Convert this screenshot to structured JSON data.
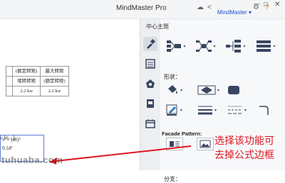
{
  "app": {
    "title": "MindMaster Pro",
    "brand": "MindMaster",
    "brand_chevron": "▾"
  },
  "document": {
    "table": [
      [
        "",
        "(额定转矩)",
        "最大转矩"
      ],
      [
        "",
        "堵转转矩",
        "(额定转矩)"
      ],
      [
        "",
        "2.2 kw",
        "2.2 kw"
      ]
    ],
    "formula_line1": "τ² + (ατ)²",
    "formula_line2": "0.1d³",
    "formula_rhs": "≤ [σ₋₁]ₚ"
  },
  "panel": {
    "title": "中心主题",
    "shape_label": "形状：",
    "facade_label": "Facade Pattern:",
    "bottom_label": "分支："
  },
  "annotation": {
    "line1": "选择该功能可",
    "line2": "去掉公式边框"
  },
  "watermark": "tuhuaba.com",
  "colors": {
    "accent": "#1f4fcf",
    "annotation": "#e0141f",
    "icon": "#3a4660"
  }
}
